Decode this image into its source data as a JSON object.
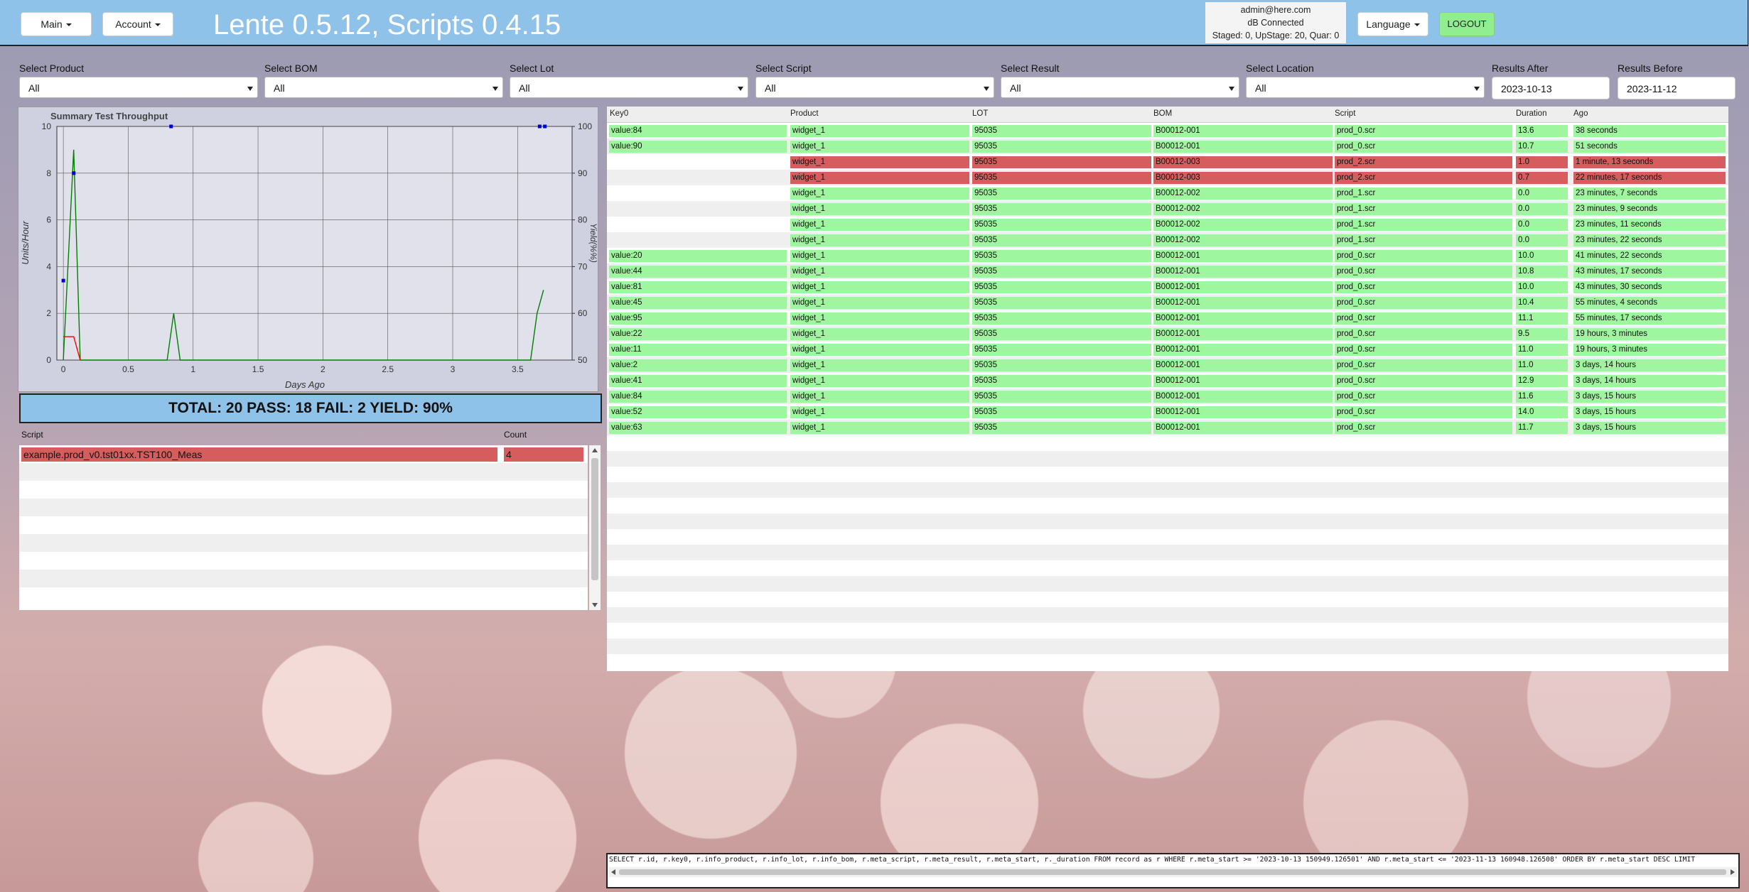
{
  "header": {
    "main_label": "Main",
    "account_label": "Account",
    "title": "Lente 0.5.12, Scripts 0.4.15",
    "user": "admin@here.com",
    "db_status": "dB Connected",
    "stage_status": "Staged: 0, UpStage: 20, Quar: 0",
    "language_label": "Language",
    "logout_label": "LOGOUT"
  },
  "filters": {
    "product": {
      "label": "Select Product",
      "value": "All"
    },
    "bom": {
      "label": "Select BOM",
      "value": "All"
    },
    "lot": {
      "label": "Select Lot",
      "value": "All"
    },
    "script": {
      "label": "Select Script",
      "value": "All"
    },
    "result": {
      "label": "Select Result",
      "value": "All"
    },
    "location": {
      "label": "Select Location",
      "value": "All"
    },
    "after": {
      "label": "Results After",
      "value": "2023-10-13"
    },
    "before": {
      "label": "Results Before",
      "value": "2023-11-12"
    }
  },
  "chart_data": {
    "type": "line",
    "title": "Summary Test Throughput",
    "xlabel": "Days Ago",
    "ylabel": "Units/Hour",
    "y2label": "Yield(%%)",
    "xlim": [
      -0.05,
      3.92
    ],
    "ylim": [
      0,
      10
    ],
    "y2lim": [
      50,
      100
    ],
    "xticks": [
      0,
      0.5,
      1,
      1.5,
      2,
      2.5,
      3,
      3.5
    ],
    "yticks": [
      0,
      2,
      4,
      6,
      8,
      10
    ],
    "y2ticks": [
      50,
      60,
      70,
      80,
      90,
      100
    ],
    "grid": true,
    "series": [
      {
        "color": "#008000",
        "axis": "left",
        "x": [
          0,
          0.08,
          0.13,
          0.8,
          0.85,
          0.9,
          3.6,
          3.65,
          3.7
        ],
        "y": [
          0,
          9,
          0,
          0,
          2,
          0,
          0,
          2,
          3
        ]
      },
      {
        "color": "#ff0000",
        "axis": "left",
        "x": [
          0,
          0.08,
          0.13
        ],
        "y": [
          1,
          1,
          0
        ]
      },
      {
        "color": "#0000cc",
        "axis": "right",
        "marker": "square",
        "x": [
          0,
          0.08,
          0.83,
          3.67,
          3.71
        ],
        "y": [
          67,
          90,
          100,
          100,
          100
        ]
      }
    ]
  },
  "summary": "TOTAL: 20 PASS: 18 FAIL: 2 YIELD: 90%",
  "script_table": {
    "columns": [
      "Script",
      "Count"
    ],
    "rows": [
      {
        "script": "example.prod_v0.tst01xx.TST100_Meas",
        "count": "4",
        "status": "fail"
      }
    ]
  },
  "results_table": {
    "columns": [
      "Key0",
      "Product",
      "LOT",
      "BOM",
      "Script",
      "Duration",
      "Ago"
    ],
    "rows": [
      {
        "key0": "value:84",
        "product": "widget_1",
        "lot": "95035",
        "bom": "B00012-001",
        "script": "prod_0.scr",
        "duration": "13.6",
        "ago": "38 seconds",
        "status": "pass"
      },
      {
        "key0": "value:90",
        "product": "widget_1",
        "lot": "95035",
        "bom": "B00012-001",
        "script": "prod_0.scr",
        "duration": "10.7",
        "ago": "51 seconds",
        "status": "pass"
      },
      {
        "key0": "",
        "product": "widget_1",
        "lot": "95035",
        "bom": "B00012-003",
        "script": "prod_2.scr",
        "duration": "1.0",
        "ago": "1 minute, 13 seconds",
        "status": "fail"
      },
      {
        "key0": "",
        "product": "widget_1",
        "lot": "95035",
        "bom": "B00012-003",
        "script": "prod_2.scr",
        "duration": "0.7",
        "ago": "22 minutes, 17 seconds",
        "status": "fail"
      },
      {
        "key0": "",
        "product": "widget_1",
        "lot": "95035",
        "bom": "B00012-002",
        "script": "prod_1.scr",
        "duration": "0.0",
        "ago": "23 minutes, 7 seconds",
        "status": "pass"
      },
      {
        "key0": "",
        "product": "widget_1",
        "lot": "95035",
        "bom": "B00012-002",
        "script": "prod_1.scr",
        "duration": "0.0",
        "ago": "23 minutes, 9 seconds",
        "status": "pass"
      },
      {
        "key0": "",
        "product": "widget_1",
        "lot": "95035",
        "bom": "B00012-002",
        "script": "prod_1.scr",
        "duration": "0.0",
        "ago": "23 minutes, 11 seconds",
        "status": "pass"
      },
      {
        "key0": "",
        "product": "widget_1",
        "lot": "95035",
        "bom": "B00012-002",
        "script": "prod_1.scr",
        "duration": "0.0",
        "ago": "23 minutes, 22 seconds",
        "status": "pass"
      },
      {
        "key0": "value:20",
        "product": "widget_1",
        "lot": "95035",
        "bom": "B00012-001",
        "script": "prod_0.scr",
        "duration": "10.0",
        "ago": "41 minutes, 22 seconds",
        "status": "pass"
      },
      {
        "key0": "value:44",
        "product": "widget_1",
        "lot": "95035",
        "bom": "B00012-001",
        "script": "prod_0.scr",
        "duration": "10.8",
        "ago": "43 minutes, 17 seconds",
        "status": "pass"
      },
      {
        "key0": "value:81",
        "product": "widget_1",
        "lot": "95035",
        "bom": "B00012-001",
        "script": "prod_0.scr",
        "duration": "10.0",
        "ago": "43 minutes, 30 seconds",
        "status": "pass"
      },
      {
        "key0": "value:45",
        "product": "widget_1",
        "lot": "95035",
        "bom": "B00012-001",
        "script": "prod_0.scr",
        "duration": "10.4",
        "ago": "55 minutes, 4 seconds",
        "status": "pass"
      },
      {
        "key0": "value:95",
        "product": "widget_1",
        "lot": "95035",
        "bom": "B00012-001",
        "script": "prod_0.scr",
        "duration": "11.1",
        "ago": "55 minutes, 17 seconds",
        "status": "pass"
      },
      {
        "key0": "value:22",
        "product": "widget_1",
        "lot": "95035",
        "bom": "B00012-001",
        "script": "prod_0.scr",
        "duration": "9.5",
        "ago": "19 hours, 3 minutes",
        "status": "pass"
      },
      {
        "key0": "value:11",
        "product": "widget_1",
        "lot": "95035",
        "bom": "B00012-001",
        "script": "prod_0.scr",
        "duration": "11.0",
        "ago": "19 hours, 3 minutes",
        "status": "pass"
      },
      {
        "key0": "value:2",
        "product": "widget_1",
        "lot": "95035",
        "bom": "B00012-001",
        "script": "prod_0.scr",
        "duration": "11.0",
        "ago": "3 days, 14 hours",
        "status": "pass"
      },
      {
        "key0": "value:41",
        "product": "widget_1",
        "lot": "95035",
        "bom": "B00012-001",
        "script": "prod_0.scr",
        "duration": "12.9",
        "ago": "3 days, 14 hours",
        "status": "pass"
      },
      {
        "key0": "value:84",
        "product": "widget_1",
        "lot": "95035",
        "bom": "B00012-001",
        "script": "prod_0.scr",
        "duration": "11.6",
        "ago": "3 days, 15 hours",
        "status": "pass"
      },
      {
        "key0": "value:52",
        "product": "widget_1",
        "lot": "95035",
        "bom": "B00012-001",
        "script": "prod_0.scr",
        "duration": "14.0",
        "ago": "3 days, 15 hours",
        "status": "pass"
      },
      {
        "key0": "value:63",
        "product": "widget_1",
        "lot": "95035",
        "bom": "B00012-001",
        "script": "prod_0.scr",
        "duration": "11.7",
        "ago": "3 days, 15 hours",
        "status": "pass"
      }
    ]
  },
  "sql_query": "SELECT r.id, r.key0, r.info_product, r.info_lot, r.info_bom, r.meta_script, r.meta_result, r.meta_start, r._duration FROM record as r WHERE r.meta_start >= '2023-10-13 150949.126501'  AND r.meta_start <= '2023-11-13 160948.126508'  ORDER BY r.meta_start DESC LIMIT",
  "colors": {
    "header": "#8fc2e8",
    "pass": "#9ef79e",
    "fail": "#d65d5d",
    "logout": "#90ee90"
  }
}
